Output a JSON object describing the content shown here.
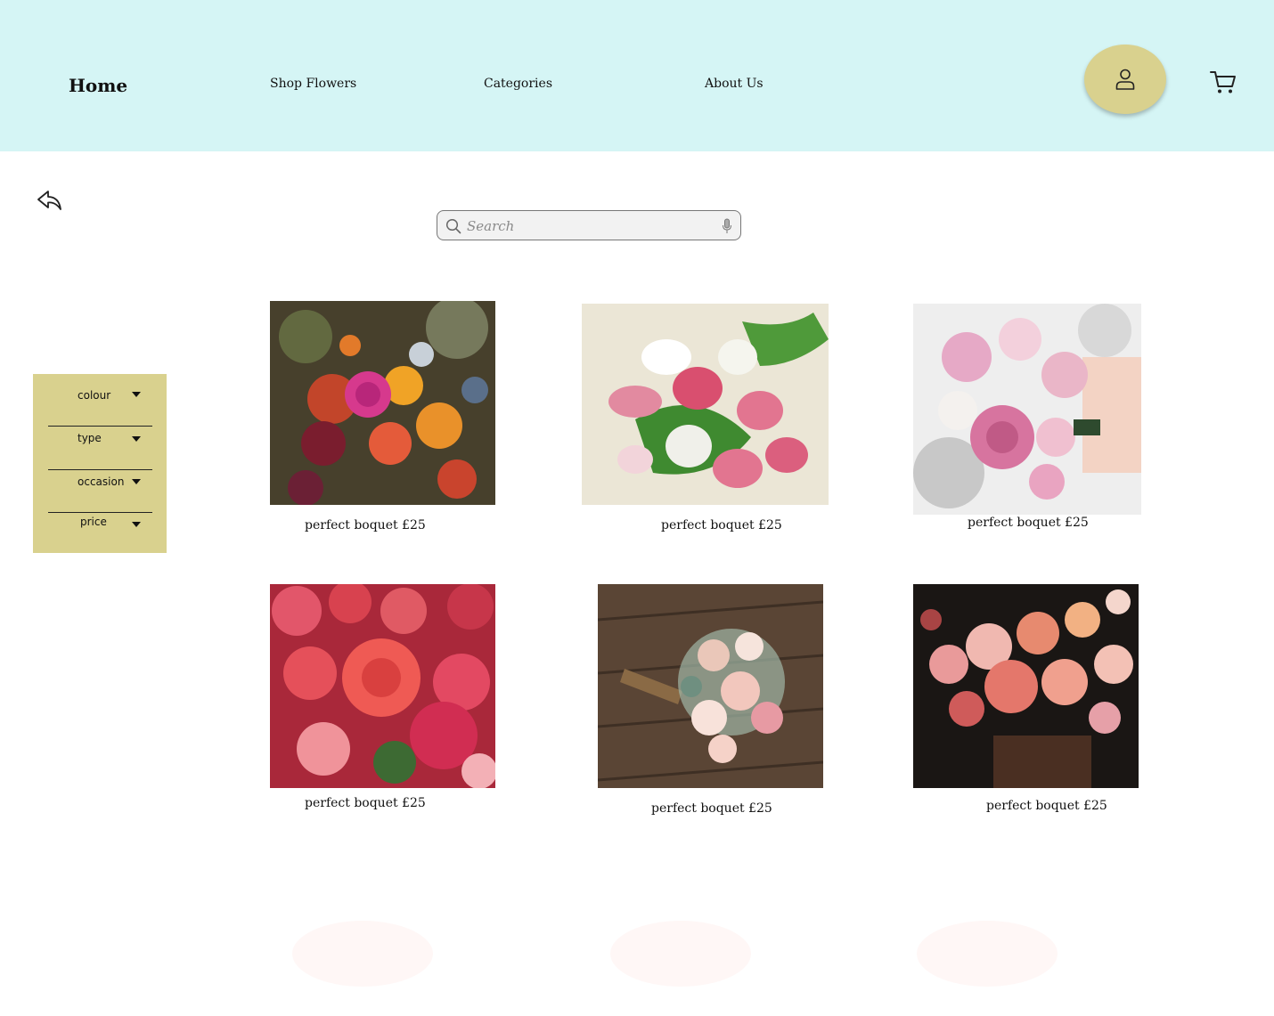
{
  "nav": {
    "home": "Home",
    "shop_flowers": "Shop Flowers",
    "categories": "Categories",
    "about_us": "About Us"
  },
  "search": {
    "placeholder": "Search"
  },
  "filters": [
    {
      "label": "colour"
    },
    {
      "label": "type"
    },
    {
      "label": "occasion"
    },
    {
      "label": "price"
    }
  ],
  "products": [
    {
      "caption": "perfect boquet £25",
      "image": "mixed autumn bouquet with roses and dahlias"
    },
    {
      "caption": "perfect boquet £25",
      "image": "pink and white tulip bouquet"
    },
    {
      "caption": "perfect boquet £25",
      "image": "pink rose bridal bouquet"
    },
    {
      "caption": "perfect boquet £25",
      "image": "coral peonies"
    },
    {
      "caption": "perfect boquet £25",
      "image": "pastel bouquet on wooden table"
    },
    {
      "caption": "perfect boquet £25",
      "image": "dahlia arrangement on dark stool"
    }
  ],
  "colors": {
    "header_bg": "#d5f5f5",
    "accent": "#d9d18e",
    "pager_dot": "#fff7f6"
  }
}
